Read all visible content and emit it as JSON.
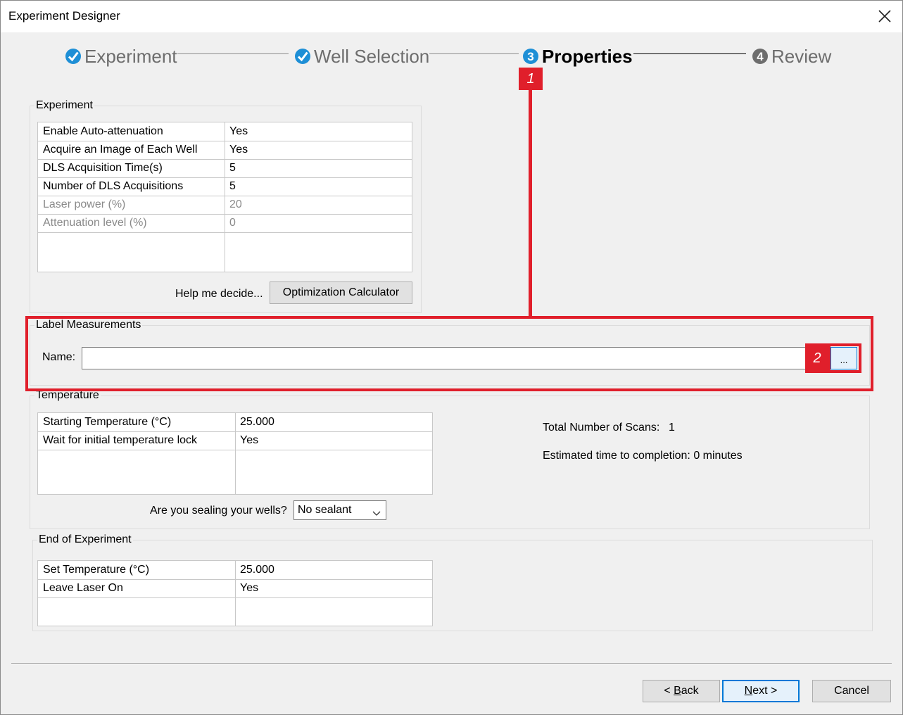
{
  "window": {
    "title": "Experiment Designer"
  },
  "steps": [
    {
      "number": "1",
      "label": "Experiment",
      "state": "complete"
    },
    {
      "number": "2",
      "label": "Well Selection",
      "state": "complete"
    },
    {
      "number": "3",
      "label": "Properties",
      "state": "active"
    },
    {
      "number": "4",
      "label": "Review",
      "state": "pending"
    }
  ],
  "experiment": {
    "title": "Experiment",
    "rows": [
      {
        "label": "Enable Auto-attenuation",
        "value": "Yes",
        "disabled": false
      },
      {
        "label": "Acquire an Image of Each Well",
        "value": "Yes",
        "disabled": false
      },
      {
        "label": "DLS Acquisition Time(s)",
        "value": "5",
        "disabled": false
      },
      {
        "label": "Number of DLS Acquisitions",
        "value": "5",
        "disabled": false
      },
      {
        "label": "Laser power (%)",
        "value": "20",
        "disabled": true
      },
      {
        "label": "Attenuation level (%)",
        "value": "0",
        "disabled": true
      }
    ],
    "help_text": "Help me decide...",
    "calc_button": "Optimization Calculator"
  },
  "label_measurements": {
    "title": "Label Measurements",
    "name_label": "Name:",
    "name_value": "",
    "browse_button": "..."
  },
  "temperature": {
    "title": "Temperature",
    "rows": [
      {
        "label": "Starting Temperature (°C)",
        "value": "25.000"
      },
      {
        "label": "Wait for initial temperature lock",
        "value": "Yes"
      }
    ],
    "sealing_question": "Are you sealing your wells?",
    "sealing_value": "No sealant",
    "total_scans_label": "Total Number of Scans:",
    "total_scans_value": "1",
    "estimated_time": "Estimated time to completion: 0 minutes"
  },
  "end_of_experiment": {
    "title": "End of Experiment",
    "rows": [
      {
        "label": "Set Temperature (°C)",
        "value": "25.000"
      },
      {
        "label": "Leave Laser On",
        "value": "Yes"
      }
    ]
  },
  "footer": {
    "back_access": "B",
    "back_rest": "ack",
    "back_prefix": "< ",
    "next_access": "N",
    "next_rest": "ext >",
    "cancel": "Cancel"
  },
  "annotations": {
    "badge1": "1",
    "badge2": "2"
  },
  "colors": {
    "annotation": "#e01f2b",
    "check": "#1e8fd6",
    "accent": "#0078d7"
  }
}
